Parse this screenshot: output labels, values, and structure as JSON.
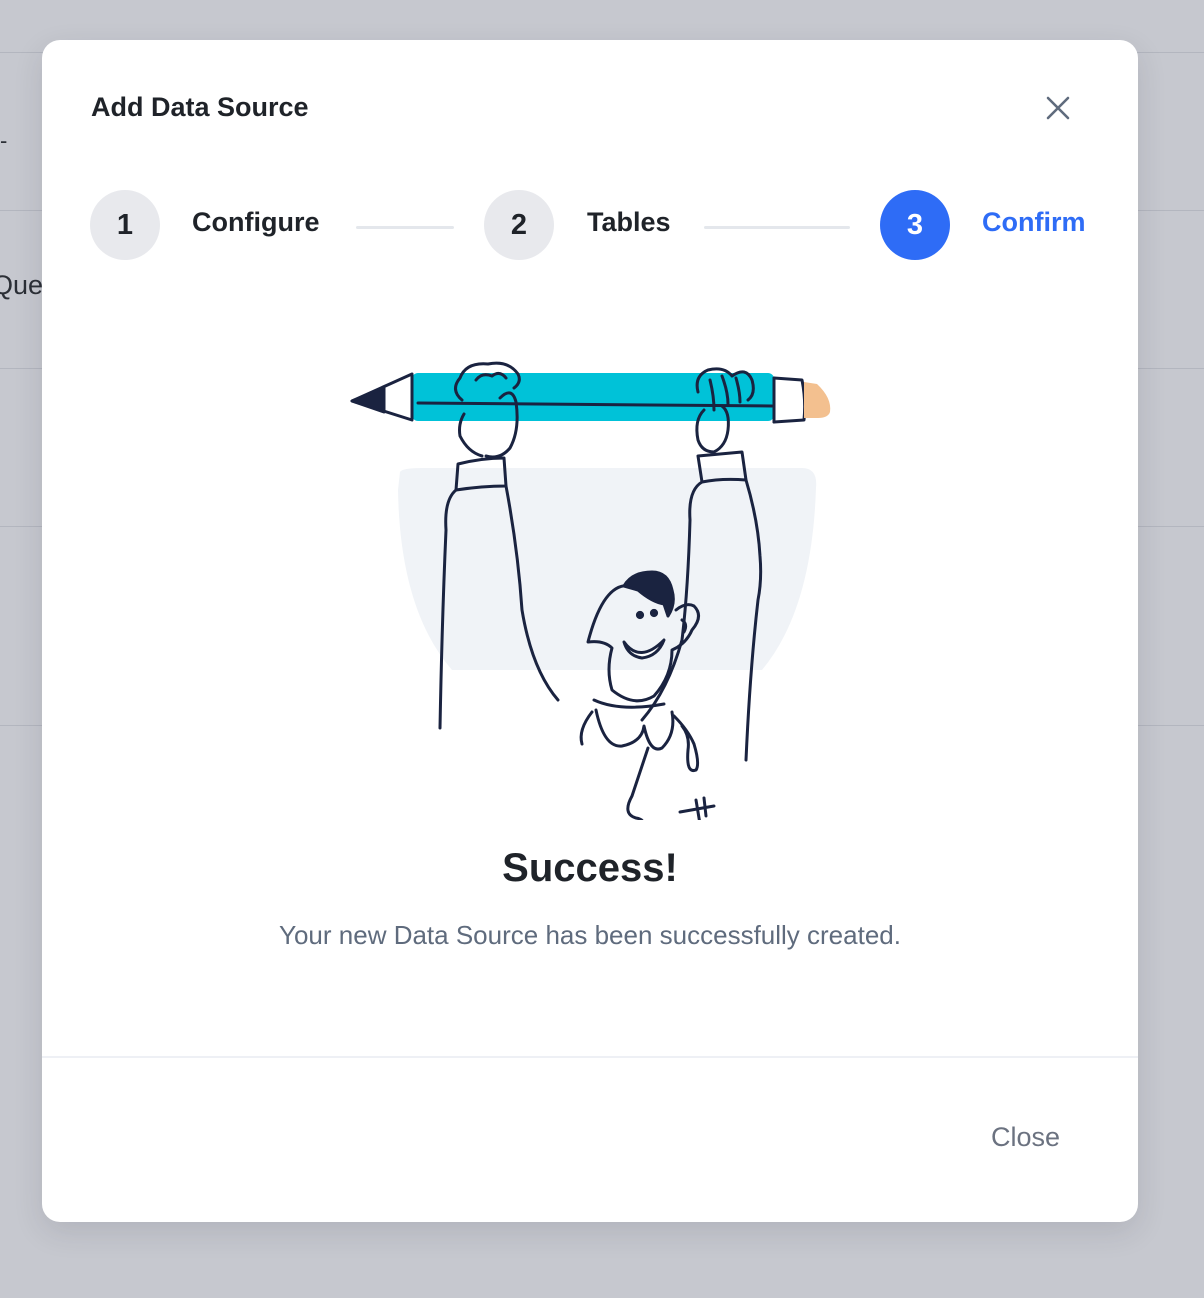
{
  "background": {
    "fragment_text": "Que",
    "tick_text": "-"
  },
  "modal": {
    "title": "Add Data Source",
    "close_icon": "close-icon",
    "stepper": {
      "steps": [
        {
          "number": "1",
          "label": "Configure",
          "active": false
        },
        {
          "number": "2",
          "label": "Tables",
          "active": false
        },
        {
          "number": "3",
          "label": "Confirm",
          "active": true
        }
      ]
    },
    "illustration": "person-lifting-pencil-illustration",
    "success": {
      "title": "Success!",
      "message": "Your new Data Source has been successfully created."
    },
    "footer": {
      "close_label": "Close"
    }
  },
  "colors": {
    "accent": "#2e6cf6",
    "pencil": "#00c2d8",
    "eraser": "#f3c08f",
    "overlay": "#c6c8cf"
  }
}
